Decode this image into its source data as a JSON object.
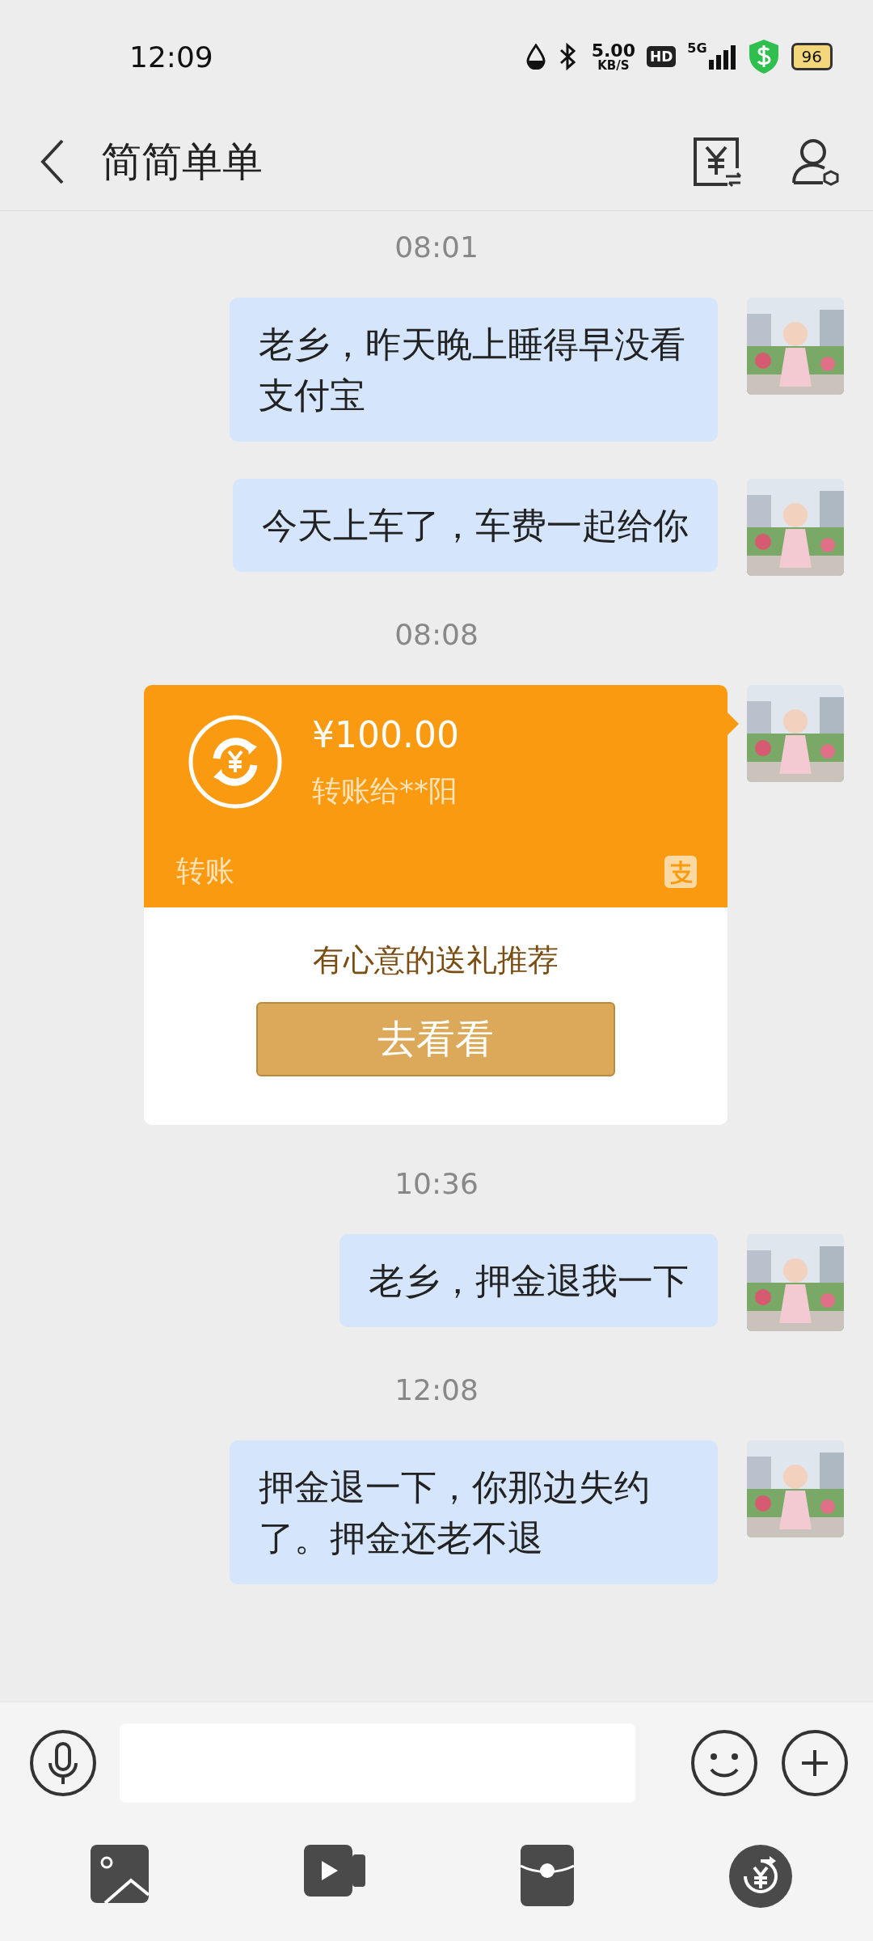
{
  "status_bar": {
    "time": "12:09",
    "speed_value": "5.00",
    "speed_unit": "KB/S",
    "hd": "HD",
    "network": "5G",
    "battery": "96"
  },
  "header": {
    "title": "简简单单"
  },
  "messages": [
    {
      "kind": "time",
      "text": "08:01"
    },
    {
      "kind": "text",
      "text": "老乡，昨天晚上睡得早没看支付宝"
    },
    {
      "kind": "text",
      "text": "今天上车了，车费一起给你"
    },
    {
      "kind": "time",
      "text": "08:08"
    },
    {
      "kind": "transfer",
      "amount": "¥100.00",
      "recipient": "转账给**阳",
      "label": "转账",
      "promo": "有心意的送礼推荐",
      "button": "去看看"
    },
    {
      "kind": "time",
      "text": "10:36"
    },
    {
      "kind": "text",
      "text": "老乡，押金退我一下"
    },
    {
      "kind": "time",
      "text": "12:08"
    },
    {
      "kind": "text",
      "text": "押金退一下，你那边失约了。押金还老不退"
    }
  ]
}
